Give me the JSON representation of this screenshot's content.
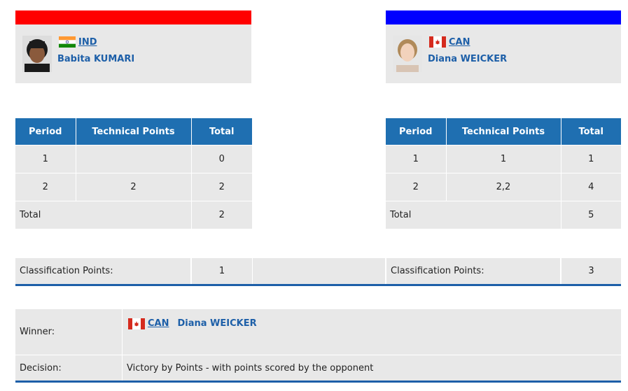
{
  "home": {
    "noc": "IND",
    "athlete": "Babita KUMARI",
    "color": "#ff0000",
    "periods": [
      {
        "period": "1",
        "technical": "",
        "total": "0"
      },
      {
        "period": "2",
        "technical": "2",
        "total": "2"
      }
    ],
    "total_label": "Total",
    "total": "2",
    "classification_label": "Classification Points:",
    "classification_points": "1"
  },
  "away": {
    "noc": "CAN",
    "athlete": "Diana WEICKER",
    "color": "#0000ff",
    "periods": [
      {
        "period": "1",
        "technical": "1",
        "total": "1"
      },
      {
        "period": "2",
        "technical": "2,2",
        "total": "4"
      }
    ],
    "total_label": "Total",
    "total": "5",
    "classification_label": "Classification Points:",
    "classification_points": "3"
  },
  "headers": {
    "period": "Period",
    "technical": "Technical Points",
    "total": "Total"
  },
  "result": {
    "winner_label": "Winner:",
    "winner_noc": "CAN",
    "winner_name": "Diana WEICKER",
    "decision_label": "Decision:",
    "decision": "Victory by Points - with points scored by the opponent"
  },
  "accent": "#1d5fa8",
  "header_color": "#1f6fb1"
}
